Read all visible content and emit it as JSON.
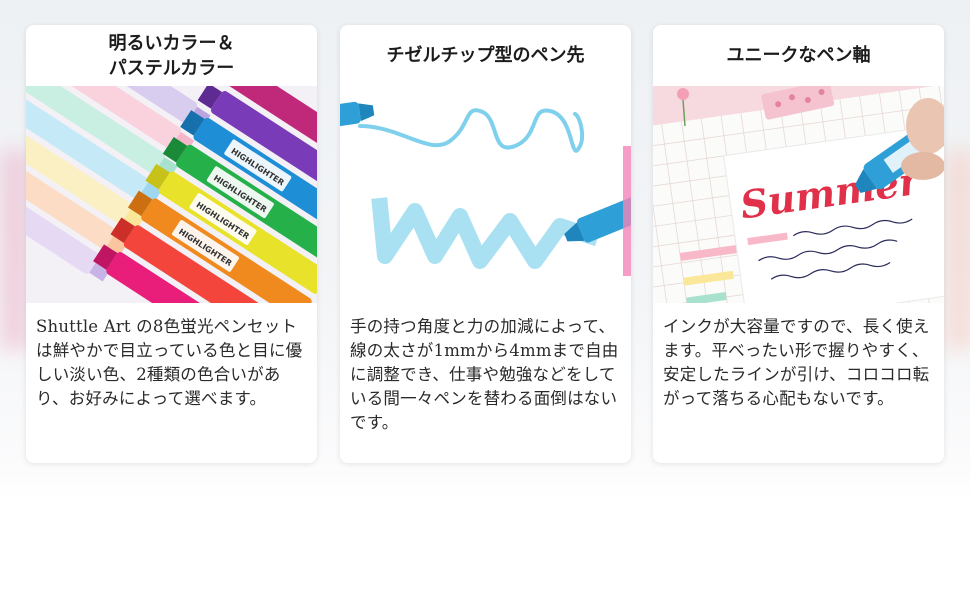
{
  "cards": [
    {
      "title": "明るいカラー＆\nパステルカラー",
      "image_subject": "pastel-highlighters-image",
      "marker_brand": "HIGHLIGHTER",
      "text": "Shuttle Art の8色蛍光ペンセットは鮮やかで目立っている色と目に優しい淡い色、2種類の色合いがあり、お好みによって選べます。"
    },
    {
      "title": "チゼルチップ型のペン先",
      "image_subject": "chisel-tip-strokes-image",
      "text": "手の持つ角度と力の加減によって、線の太さが1mmから4mmまで自由に調整でき、仕事や勉強などをしている間一々ペンを替わる面倒はないです。"
    },
    {
      "title": "ユニークなペン軸",
      "image_subject": "notebook-summer-image",
      "notebook_heading": "Summer",
      "text": "インクが大容量ですので、長く使えます。平べったい形で握りやすく、安定したラインが引け、コロコロ転がって落ちる心配もないです。"
    }
  ],
  "colors": {
    "pastel_markers": [
      "#b9a6e0",
      "#f4b6c8",
      "#a8e2cf",
      "#9fd7f0",
      "#fbe79a",
      "#fbc5a0"
    ],
    "bright_markers": [
      "#c0287a",
      "#7a3bb8",
      "#1e8fd6",
      "#25b04a",
      "#e8e22a",
      "#f08a1e",
      "#f4453c",
      "#e91e7a"
    ],
    "stroke_blue": "#7fd0ec",
    "summer_red": "#e0304a"
  }
}
